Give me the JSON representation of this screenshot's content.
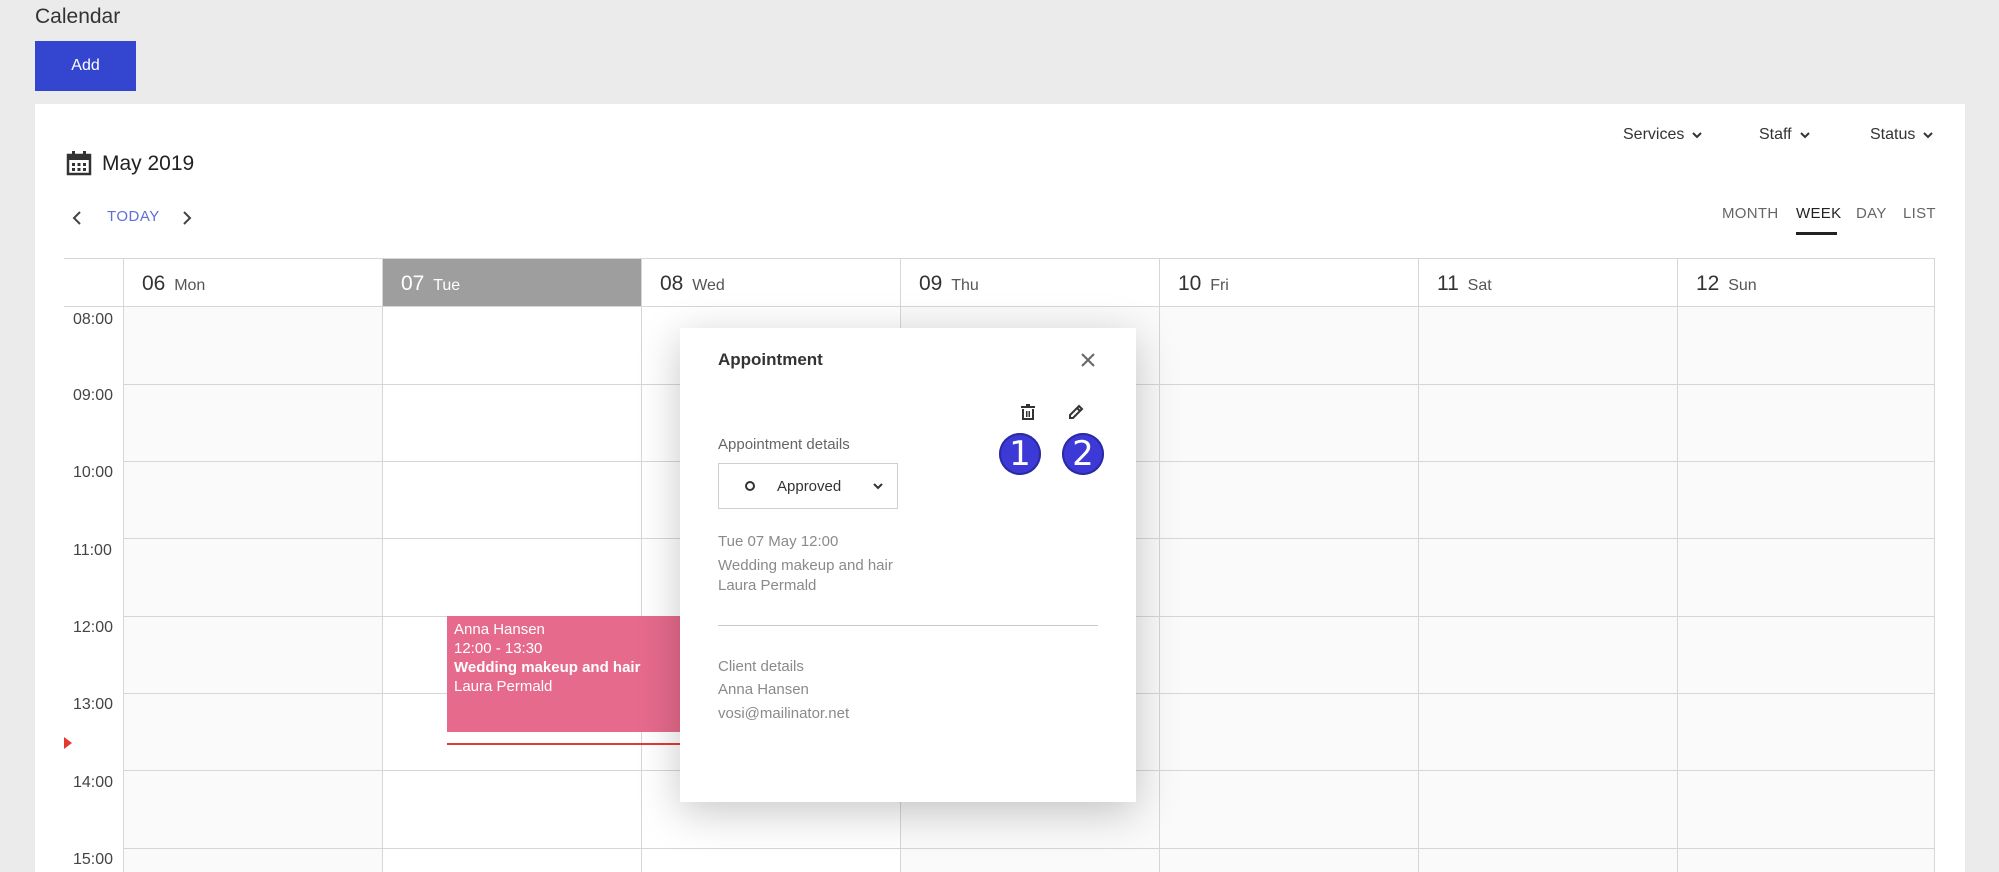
{
  "page": {
    "title": "Calendar"
  },
  "toolbar": {
    "add_label": "Add"
  },
  "filters": {
    "services": "Services",
    "staff": "Staff",
    "status": "Status"
  },
  "calendar": {
    "month_label": "May 2019",
    "today_label": "TODAY",
    "views": {
      "month": "MONTH",
      "week": "WEEK",
      "day": "DAY",
      "list": "LIST"
    },
    "active_view": "WEEK",
    "days": [
      {
        "num": "06",
        "name": "Mon"
      },
      {
        "num": "07",
        "name": "Tue"
      },
      {
        "num": "08",
        "name": "Wed"
      },
      {
        "num": "09",
        "name": "Thu"
      },
      {
        "num": "10",
        "name": "Fri"
      },
      {
        "num": "11",
        "name": "Sat"
      },
      {
        "num": "12",
        "name": "Sun"
      }
    ],
    "times": [
      "08:00",
      "09:00",
      "10:00",
      "11:00",
      "12:00",
      "13:00",
      "14:00",
      "15:00"
    ],
    "event": {
      "client": "Anna Hansen",
      "time": "12:00 - 13:30",
      "service": "Wedding makeup and hair",
      "staff": "Laura Permald",
      "color": "#e66a8c"
    }
  },
  "modal": {
    "title": "Appointment",
    "details_label": "Appointment details",
    "status_value": "Approved",
    "date": "Tue 07 May 12:00",
    "service": "Wedding makeup and hair",
    "staff": "Laura Permald",
    "client_label": "Client details",
    "client_name": "Anna Hansen",
    "client_email": "vosi@mailinator.net",
    "badges": [
      "1",
      "2"
    ]
  },
  "colors": {
    "accent": "#3446cf",
    "today_header": "#9e9e9e",
    "event": "#e66a8c",
    "badge": "#3c39d6"
  }
}
